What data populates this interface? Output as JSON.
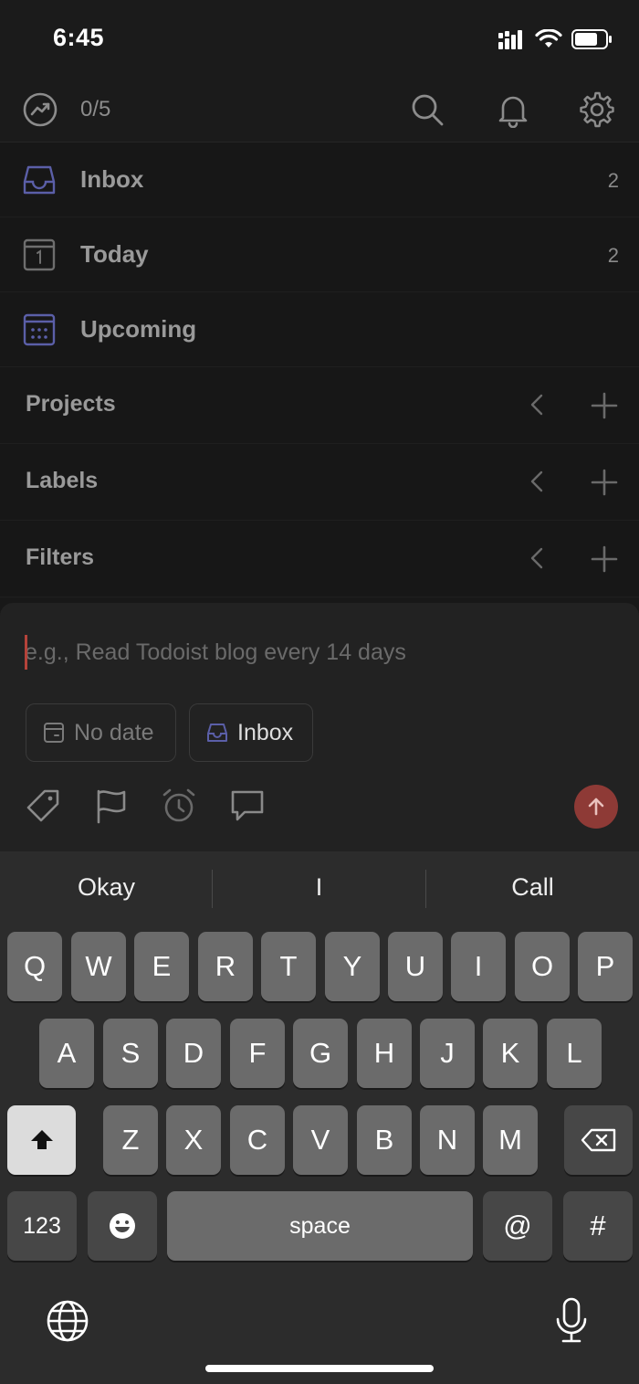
{
  "status_bar": {
    "time": "6:45"
  },
  "top_bar": {
    "karma": "0/5"
  },
  "nav": [
    {
      "label": "Inbox",
      "count": "2"
    },
    {
      "label": "Today",
      "count": "2"
    },
    {
      "label": "Upcoming",
      "count": ""
    }
  ],
  "sections": [
    {
      "label": "Projects"
    },
    {
      "label": "Labels"
    },
    {
      "label": "Filters"
    }
  ],
  "quick_add": {
    "placeholder": "e.g., Read Todoist blog every 14 days",
    "value": "",
    "date_chip": "No date",
    "project_chip": "Inbox"
  },
  "keyboard": {
    "suggestions": [
      "Okay",
      "I",
      "Call"
    ],
    "row1": [
      "Q",
      "W",
      "E",
      "R",
      "T",
      "Y",
      "U",
      "I",
      "O",
      "P"
    ],
    "row2": [
      "A",
      "S",
      "D",
      "F",
      "G",
      "H",
      "J",
      "K",
      "L"
    ],
    "row3": [
      "Z",
      "X",
      "C",
      "V",
      "B",
      "N",
      "M"
    ],
    "numbers_key": "123",
    "space_key": "space",
    "at_key": "@",
    "hash_key": "#"
  },
  "colors": {
    "accent_send": "#8e3a36",
    "inbox_icon": "#5b5fa8",
    "upcoming_icon": "#5b5fa8"
  }
}
